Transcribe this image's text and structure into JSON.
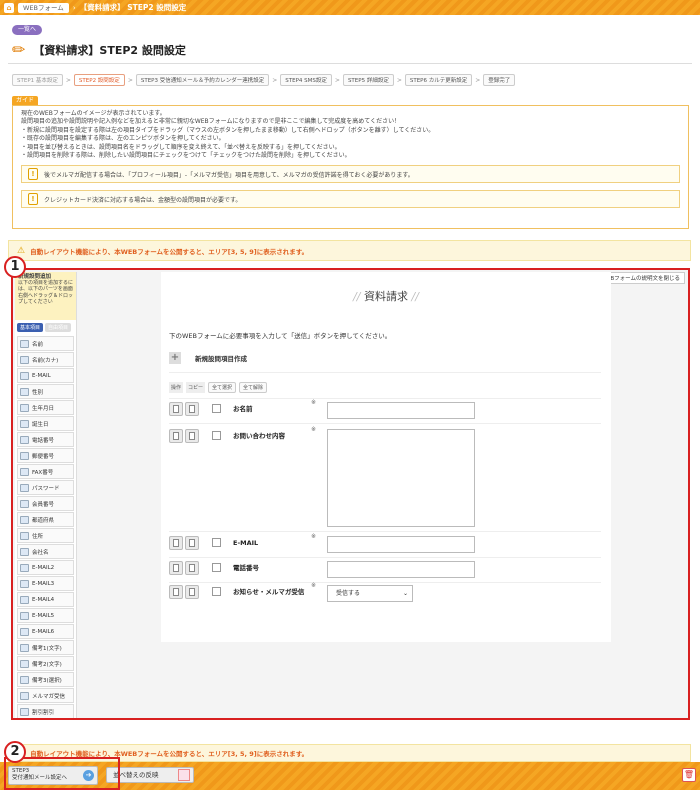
{
  "topbar": {
    "crumb1": "WEBフォーム",
    "title": "【資料請求】 STEP2 設問設定"
  },
  "back_label": "一覧へ",
  "page_title": "【資料請求】STEP2 設問設定",
  "steps": [
    {
      "label": "STEP1 基本設定",
      "state": "done"
    },
    {
      "label": "STEP2 設問設定",
      "state": "active"
    },
    {
      "label": "STEP3 受信通知メール＆予約カレンダー連携設定",
      "state": "normal"
    },
    {
      "label": "STEP4 SMS設定",
      "state": "normal"
    },
    {
      "label": "STEP5 詳細設定",
      "state": "normal"
    },
    {
      "label": "STEP6 カルテ更新設定",
      "state": "normal"
    },
    {
      "label": "登録完了",
      "state": "normal"
    }
  ],
  "guide": {
    "tab": "ガイド",
    "lines": [
      "現在のWEBフォームのイメージが表示されています。",
      "設問項目の追加や設問説明や記入例などを加えると非常に親切なWEBフォームになりますので是非ここで編集して完成度を高めてください！",
      "・新規に設問項目を設定する際は左の項目タイプをドラッグ（マウスの左ボタンを押したまま移動）して右側へドロップ（ボタンを離す）してください。",
      "・既存の設問項目を編集する際は、左のエンピツボタンを押してください。",
      "・項目を並び替えるときは、設問項目名をドラッグして順序を変え終えて、「並べ替えを反映する」を押してください。",
      "・設問項目を削除する際は、削除したい設問項目にチェックをつけて「チェックをつけた設問を削除」を押してください。"
    ],
    "notice1": "後でメルマガ配信する場合は、「プロフィール項目」-「メルマガ受信」項目を用意して、メルマガの受信許諾を得ておく必要があります。",
    "notice2": "クレジットカード決済に対応する場合は、金額型の設問項目が必要です。"
  },
  "autolayout": "自動レイアウト機能により、本WEBフォームを公開すると、エリア[3, 5, 9]に表示されます。",
  "callout1": "1",
  "callout2": "2",
  "sidebar": {
    "head_title": "新規設問追加",
    "head_text": "以下の項目を追加するには、以下のパーツを画面右側へドラッグ＆ドロップしてください",
    "tab_basic": "基本項目",
    "tab_custom": "自由項目",
    "items": [
      "名前",
      "名前(カナ)",
      "E-MAIL",
      "性別",
      "生年月日",
      "誕生日",
      "電話番号",
      "郵便番号",
      "FAX番号",
      "パスワード",
      "会員番号",
      "都道府県",
      "住所",
      "会社名",
      "E-MAIL2",
      "E-MAIL3",
      "E-MAIL4",
      "E-MAIL5",
      "E-MAIL6",
      "備考1(文字)",
      "備考2(文字)",
      "備考3(選択)",
      "メルマガ受信",
      "割引割引"
    ]
  },
  "close_desc": "WEBフォームの説明文を閉じる",
  "form": {
    "title": "資料請求",
    "intro": "下のWEBフォームに必要事項を入力して「送信」ボタンを押してください。",
    "new_item": "新規設問項目作成",
    "ops_label1": "操作",
    "ops_label2": "コピー",
    "check_all": "全て選択",
    "uncheck_all": "全て解除",
    "required_mark": "※",
    "questions": [
      {
        "label": "お名前",
        "type": "input"
      },
      {
        "label": "お問い合わせ内容",
        "type": "textarea"
      },
      {
        "label": "E-MAIL",
        "type": "input"
      },
      {
        "label": "電話番号",
        "type": "input"
      },
      {
        "label": "お知らせ・メルマガ受信",
        "type": "select",
        "value": "受信する"
      }
    ]
  },
  "bottom": {
    "step3_line1": "STEP3",
    "step3_line2": "受付通知メール設定へ",
    "reorder": "並べ替えの反映"
  }
}
